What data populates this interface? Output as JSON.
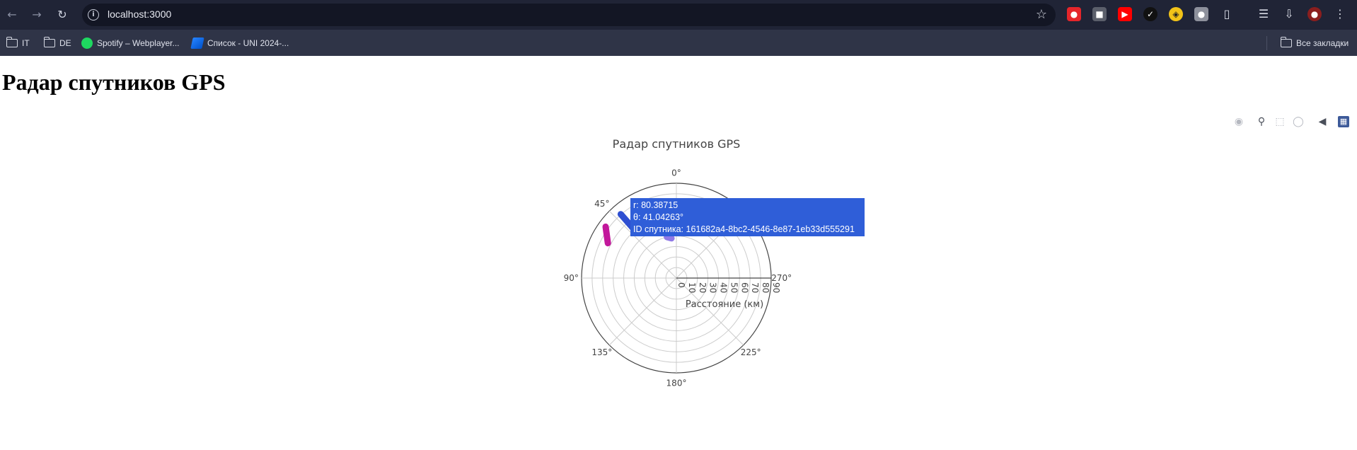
{
  "browser": {
    "url": "localhost:3000",
    "bookmarks": [
      "IT",
      "DE",
      "Spotify – Webplayer...",
      "Список - UNI 2024-..."
    ],
    "all_bookmarks": "Все закладки"
  },
  "page": {
    "heading": "Радар спутников GPS"
  },
  "chart_data": {
    "type": "scatter",
    "subtype": "polar",
    "title": "Радар спутников GPS",
    "radial_axis_title": "Расстояние (км)",
    "radial_range": [
      0,
      90
    ],
    "radial_ticks": [
      "0",
      "10",
      "20",
      "30",
      "40",
      "50",
      "60",
      "70",
      "80",
      "90"
    ],
    "angular_ticks": [
      "0°",
      "45°",
      "90°",
      "135°",
      "180°",
      "225°",
      "270°"
    ],
    "angular_direction": "counterclockwise",
    "rotation_deg": 90,
    "grid": true,
    "series": [
      {
        "color": "#c2189b",
        "points": [
          [
            73,
            63
          ],
          [
            83,
            54
          ]
        ]
      },
      {
        "color": "#2e4fd1",
        "points": [
          [
            58,
            41
          ],
          [
            80.38715,
            41.04263
          ]
        ]
      },
      {
        "color": "#9079e6",
        "points": [
          [
            38,
            7
          ],
          [
            40,
            13
          ]
        ]
      }
    ],
    "hover": {
      "r": "r: 80.38715",
      "theta": "θ: 41.04263°",
      "id": "ID спутника: 161682a4-8bc2-4546-8e87-1eb33d555291"
    }
  }
}
